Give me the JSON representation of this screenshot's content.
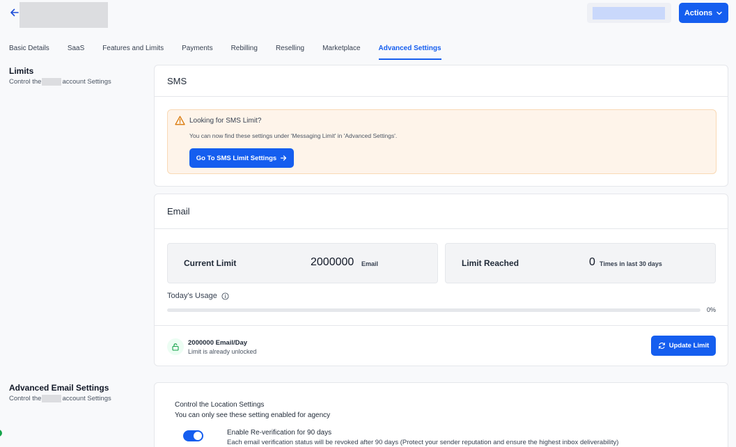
{
  "header": {
    "actions_label": "Actions"
  },
  "tabs": [
    {
      "label": "Basic Details"
    },
    {
      "label": "SaaS"
    },
    {
      "label": "Features and Limits"
    },
    {
      "label": "Payments"
    },
    {
      "label": "Rebilling"
    },
    {
      "label": "Reselling"
    },
    {
      "label": "Marketplace"
    },
    {
      "label": "Advanced Settings"
    }
  ],
  "limits_section": {
    "title": "Limits",
    "subtitle_prefix": "Control the",
    "subtitle_suffix": "account Settings"
  },
  "sms_card": {
    "title": "SMS",
    "alert_title": "Looking for SMS Limit?",
    "alert_body": "You can now find these settings under 'Messaging Limit' in 'Advanced Settings'.",
    "button_label": "Go To SMS Limit Settings"
  },
  "email_card": {
    "title": "Email",
    "current_limit_label": "Current Limit",
    "current_limit_value": "2000000",
    "current_limit_unit": "Email",
    "limit_reached_label": "Limit Reached",
    "limit_reached_value": "0",
    "limit_reached_unit": "Times in last 30 days",
    "usage_label": "Today's Usage",
    "usage_fraction": 0,
    "usage_text": "0%",
    "footer_limit": "2000000 Email/Day",
    "footer_status": "Limit is already unlocked",
    "update_label": "Update Limit"
  },
  "advanced_email_section": {
    "title": "Advanced Email Settings",
    "subtitle_prefix": "Control the",
    "subtitle_suffix": "account Settings",
    "heading": "Control the Location Settings",
    "sub": "You can only see these setting enabled for agency",
    "option_title": "Enable Re-verification for 90 days",
    "option_desc": "Each email verification status will be revoked after 90 days (Protect your sender reputation and ensure the highest inbox deliverability)",
    "option_enabled": true
  },
  "colors": {
    "accent": "#155eef",
    "alert_bg": "#fef4ea",
    "success": "#16a34a"
  },
  "icons": [
    "arrow-left-icon",
    "chevron-down-icon",
    "warning-icon",
    "arrow-right-icon",
    "info-icon",
    "unlock-icon",
    "refresh-icon"
  ]
}
